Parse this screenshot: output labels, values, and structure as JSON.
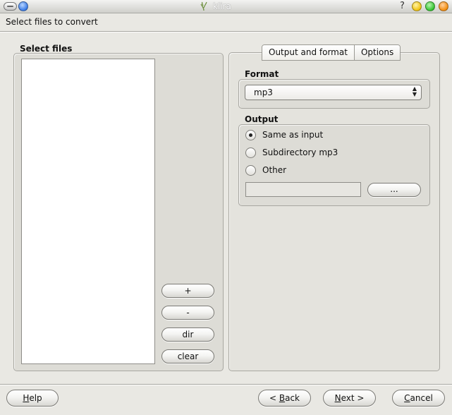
{
  "window": {
    "title": "klira",
    "help_glyph": "?"
  },
  "header": {
    "subtitle": "Select files to convert"
  },
  "select_files": {
    "title": "Select files",
    "files": [],
    "buttons": {
      "add": "+",
      "remove": "-",
      "dir": "dir",
      "clear": "clear"
    }
  },
  "tabs": [
    {
      "label": "Output and format"
    },
    {
      "label": "Options"
    }
  ],
  "format": {
    "title": "Format",
    "selected": "mp3",
    "arrows": "▲\n▼"
  },
  "output": {
    "title": "Output",
    "options": [
      {
        "label": "Same as input",
        "checked": true
      },
      {
        "label": "Subdirectory mp3",
        "checked": false
      },
      {
        "label": "Other",
        "checked": false
      }
    ],
    "path_value": "",
    "browse_label": "..."
  },
  "footer": {
    "help": {
      "accel": "H",
      "rest": "elp"
    },
    "back": {
      "prefix": "< ",
      "accel": "B",
      "rest": "ack"
    },
    "next": {
      "accel": "N",
      "rest": "ext >"
    },
    "cancel": {
      "accel": "C",
      "rest": "ancel"
    }
  },
  "colors": {
    "window_bg": "#e9e8e3",
    "group_bg": "#dddcd6",
    "titlebar_close": "#f0c20f",
    "titlebar_max": "#32c22f",
    "titlebar_min": "#f28c0c",
    "titlebar_blue": "#3a7be6"
  }
}
